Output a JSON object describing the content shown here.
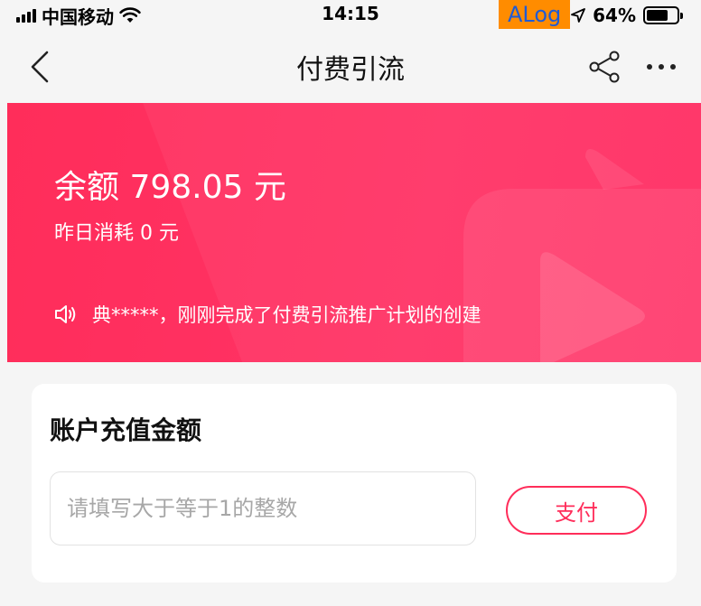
{
  "status_bar": {
    "carrier": "中国移动",
    "time": "14:15",
    "debug_tag": "ALog",
    "battery_percent": "64%",
    "battery_level": 0.64
  },
  "nav": {
    "title": "付费引流"
  },
  "banner": {
    "balance": "余额 798.05 元",
    "yesterday_cost": "昨日消耗 0 元",
    "notice": "典*****，刚刚完成了付费引流推广计划的创建"
  },
  "recharge": {
    "title": "账户充值金额",
    "placeholder": "请填写大于等于1的整数",
    "value": "",
    "pay_label": "支付"
  },
  "colors": {
    "accent": "#ff2d5a",
    "debug_tag_bg": "#ff8c00",
    "debug_tag_text": "#1f5bd6"
  }
}
